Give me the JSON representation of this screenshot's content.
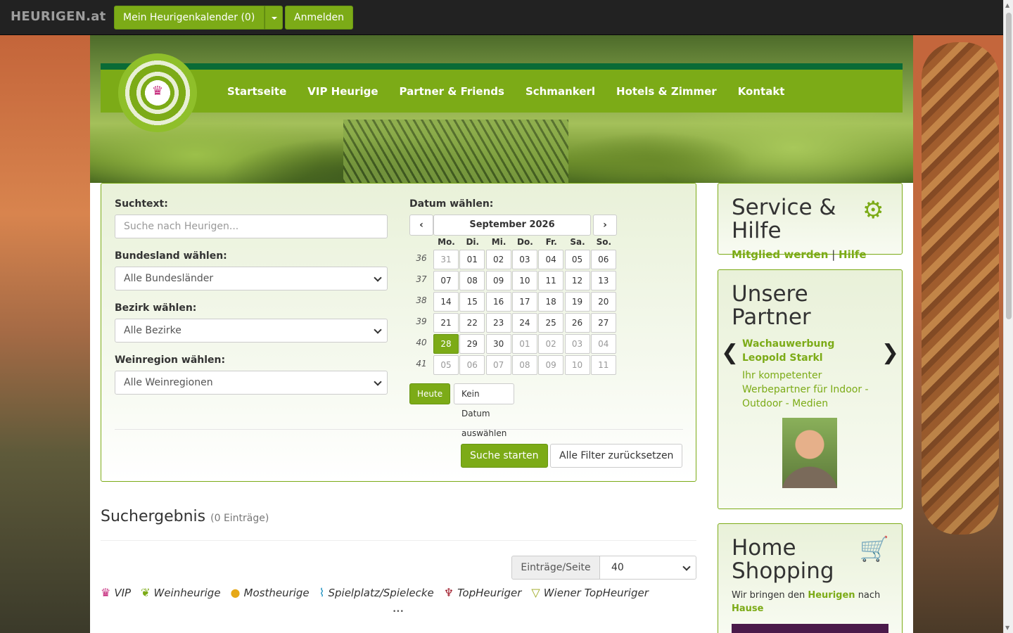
{
  "navbar": {
    "brand": "HEURIGEN.at",
    "calendar_button": "Mein Heurigenkalender (0)",
    "login_button": "Anmelden"
  },
  "menu": [
    "Startseite",
    "VIP Heurige",
    "Partner & Friends",
    "Schmankerl",
    "Hotels & Zimmer",
    "Kontakt"
  ],
  "search": {
    "text_label": "Suchtext:",
    "text_placeholder": "Suche nach Heurigen...",
    "state_label": "Bundesland wählen:",
    "state_value": "Alle Bundesländer",
    "district_label": "Bezirk wählen:",
    "district_value": "Alle Bezirke",
    "region_label": "Weinregion wählen:",
    "region_value": "Alle Weinregionen",
    "date_label": "Datum wählen:",
    "submit": "Suche starten",
    "reset": "Alle Filter zurücksetzen"
  },
  "calendar": {
    "month": "September 2026",
    "weekdays": [
      "Mo.",
      "Di.",
      "Mi.",
      "Do.",
      "Fr.",
      "Sa.",
      "So."
    ],
    "weeks": [
      {
        "nr": "36",
        "days": [
          "31",
          "01",
          "02",
          "03",
          "04",
          "05",
          "06"
        ]
      },
      {
        "nr": "37",
        "days": [
          "07",
          "08",
          "09",
          "10",
          "11",
          "12",
          "13"
        ]
      },
      {
        "nr": "38",
        "days": [
          "14",
          "15",
          "16",
          "17",
          "18",
          "19",
          "20"
        ]
      },
      {
        "nr": "39",
        "days": [
          "21",
          "22",
          "23",
          "24",
          "25",
          "26",
          "27"
        ]
      },
      {
        "nr": "40",
        "days": [
          "28",
          "29",
          "30",
          "01",
          "02",
          "03",
          "04"
        ]
      },
      {
        "nr": "41",
        "days": [
          "05",
          "06",
          "07",
          "08",
          "09",
          "10",
          "11"
        ]
      }
    ],
    "selected": "28",
    "today_button": "Heute",
    "no_date_button": "Kein Datum auswählen"
  },
  "results": {
    "title": "Suchergebnis",
    "count": "(0 Einträge)",
    "per_page_label": "Einträge/Seite",
    "per_page_value": "40",
    "legend": [
      {
        "icon": "crown-icon",
        "label": "VIP",
        "color": "#c4267a"
      },
      {
        "icon": "grapes-icon",
        "label": "Weinheurige",
        "color": "#7cab17"
      },
      {
        "icon": "pear-icon",
        "label": "Mostheurige",
        "color": "#e6a817"
      },
      {
        "icon": "slide-icon",
        "label": "Spielplatz/Spielecke",
        "color": "#1a8fbf"
      },
      {
        "icon": "wine-glass-icon",
        "label": "TopHeuriger",
        "color": "#a01b2a"
      },
      {
        "icon": "vine-icon",
        "label": "Wiener TopHeuriger",
        "color": "#9aa61a"
      }
    ]
  },
  "service": {
    "title": "Service & Hilfe",
    "link1": "Mitglied werden",
    "sep": "|",
    "link2": "Hilfe"
  },
  "partner": {
    "title": "Unsere Partner",
    "name": "Wachauwerbung Leopold Starkl",
    "desc": "Ihr kompetenter Werbepartner für Indoor - Outdoor - Medien"
  },
  "shop": {
    "title": "Home Shopping",
    "text1": "Wir bringen den ",
    "link": "Heurigen",
    "text2": " nach ",
    "link2": "Hause"
  },
  "colors": {
    "accent": "#7cab17",
    "dark_green": "#0a6b36",
    "topbar": "#222222"
  }
}
